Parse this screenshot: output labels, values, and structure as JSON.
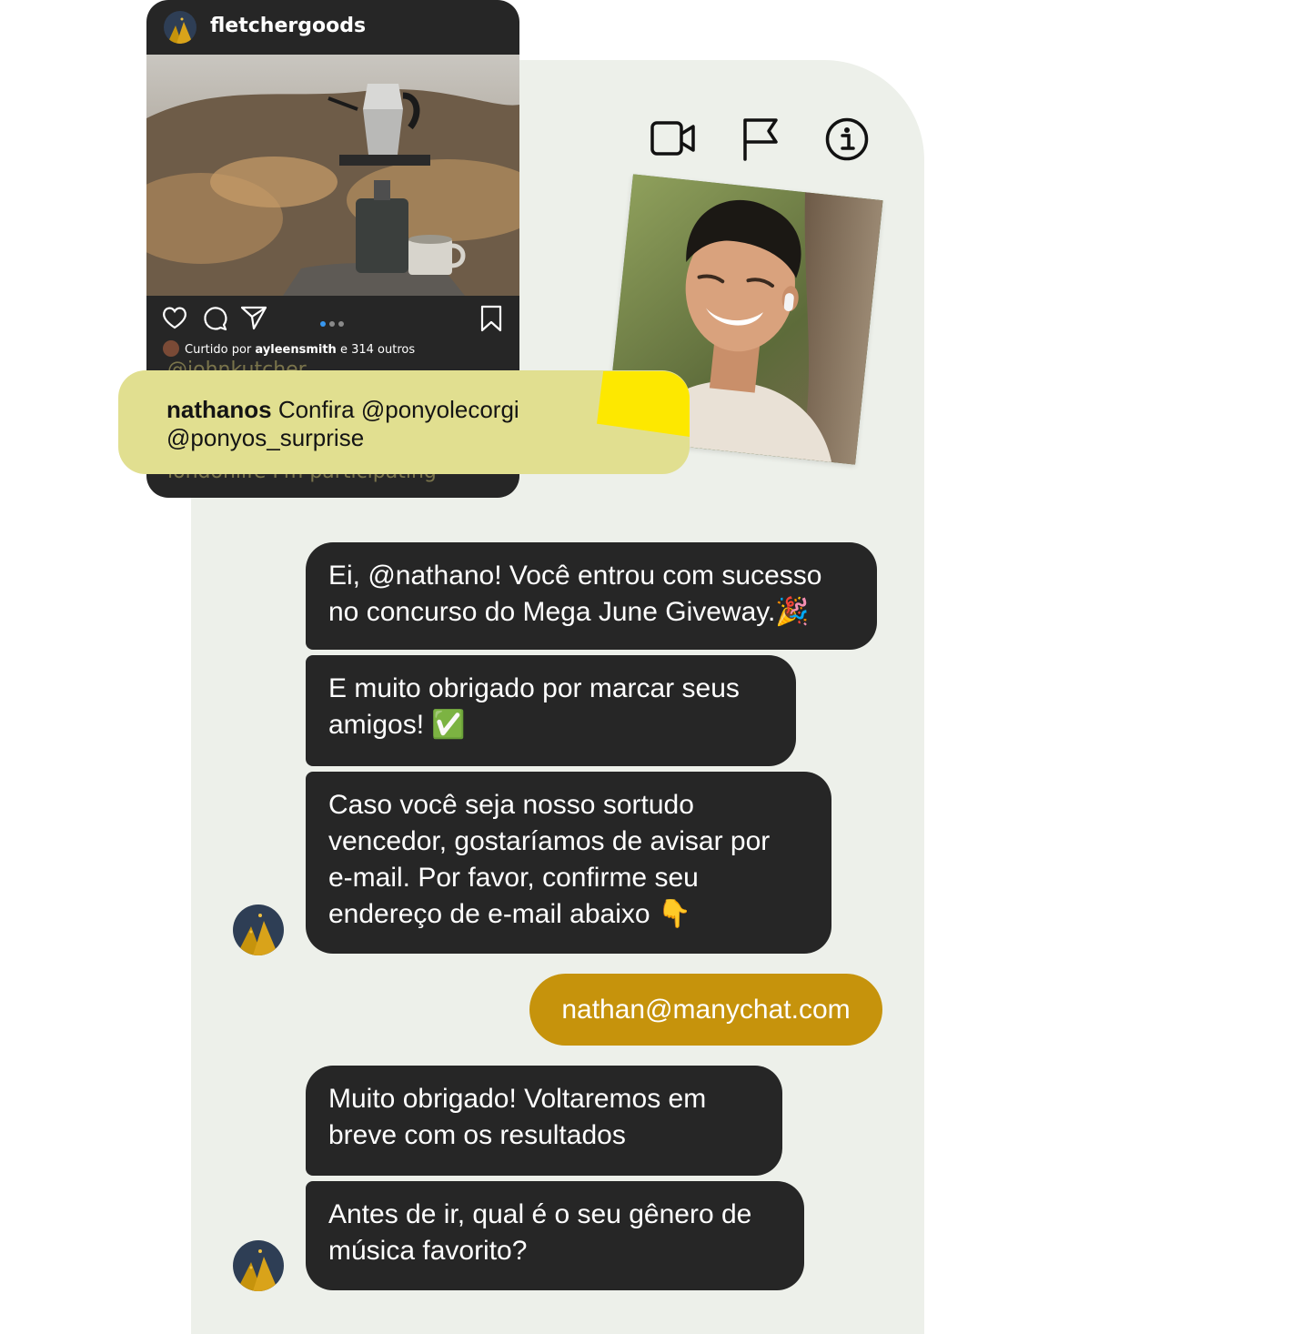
{
  "post": {
    "username": "fletchergoods",
    "liked_prefix": "Curtido por",
    "liked_user": "ayleensmith",
    "liked_suffix": "e 314 outros",
    "faded_comment_top": "@johnkutcher",
    "faded_comment_bottom": "londonlife I'm participating",
    "carousel_dots": 3,
    "carousel_active": 1
  },
  "comment": {
    "user": "nathanos",
    "text_line1": "Confira @ponyolecorgi",
    "text_line2": "@ponyos_surprise"
  },
  "header_icons": [
    "video-call-icon",
    "flag-icon",
    "info-icon"
  ],
  "messages": [
    {
      "from": "bot",
      "lines": [
        "Ei, @nathano! Você entrou com sucesso",
        "no concurso do  Mega June Giveway."
      ],
      "emoji": "🎉"
    },
    {
      "from": "bot",
      "lines": [
        "E muito obrigado por marcar seus",
        "amigos!"
      ],
      "emoji": "✅"
    },
    {
      "from": "bot",
      "lines": [
        "Caso você seja nosso sortudo",
        "vencedor, gostaríamos de avisar por",
        "e-mail. Por favor, confirme seu",
        "endereço de e-mail abaixo"
      ],
      "emoji": "👇"
    },
    {
      "from": "user",
      "text": "nathan@manychat.com"
    },
    {
      "from": "bot",
      "lines": [
        "Muito obrigado! Voltaremos em",
        "breve com os resultados"
      ]
    },
    {
      "from": "bot",
      "lines": [
        "Antes de ir, qual é o seu gênero de",
        "música favorito?"
      ]
    }
  ],
  "colors": {
    "panel_bg": "#edf0ea",
    "bot_bubble": "#262626",
    "user_bubble": "#c6930c",
    "comment_bubble": "#e1df90",
    "accent_yellow": "#fde800",
    "carousel_active": "#3897f0"
  }
}
